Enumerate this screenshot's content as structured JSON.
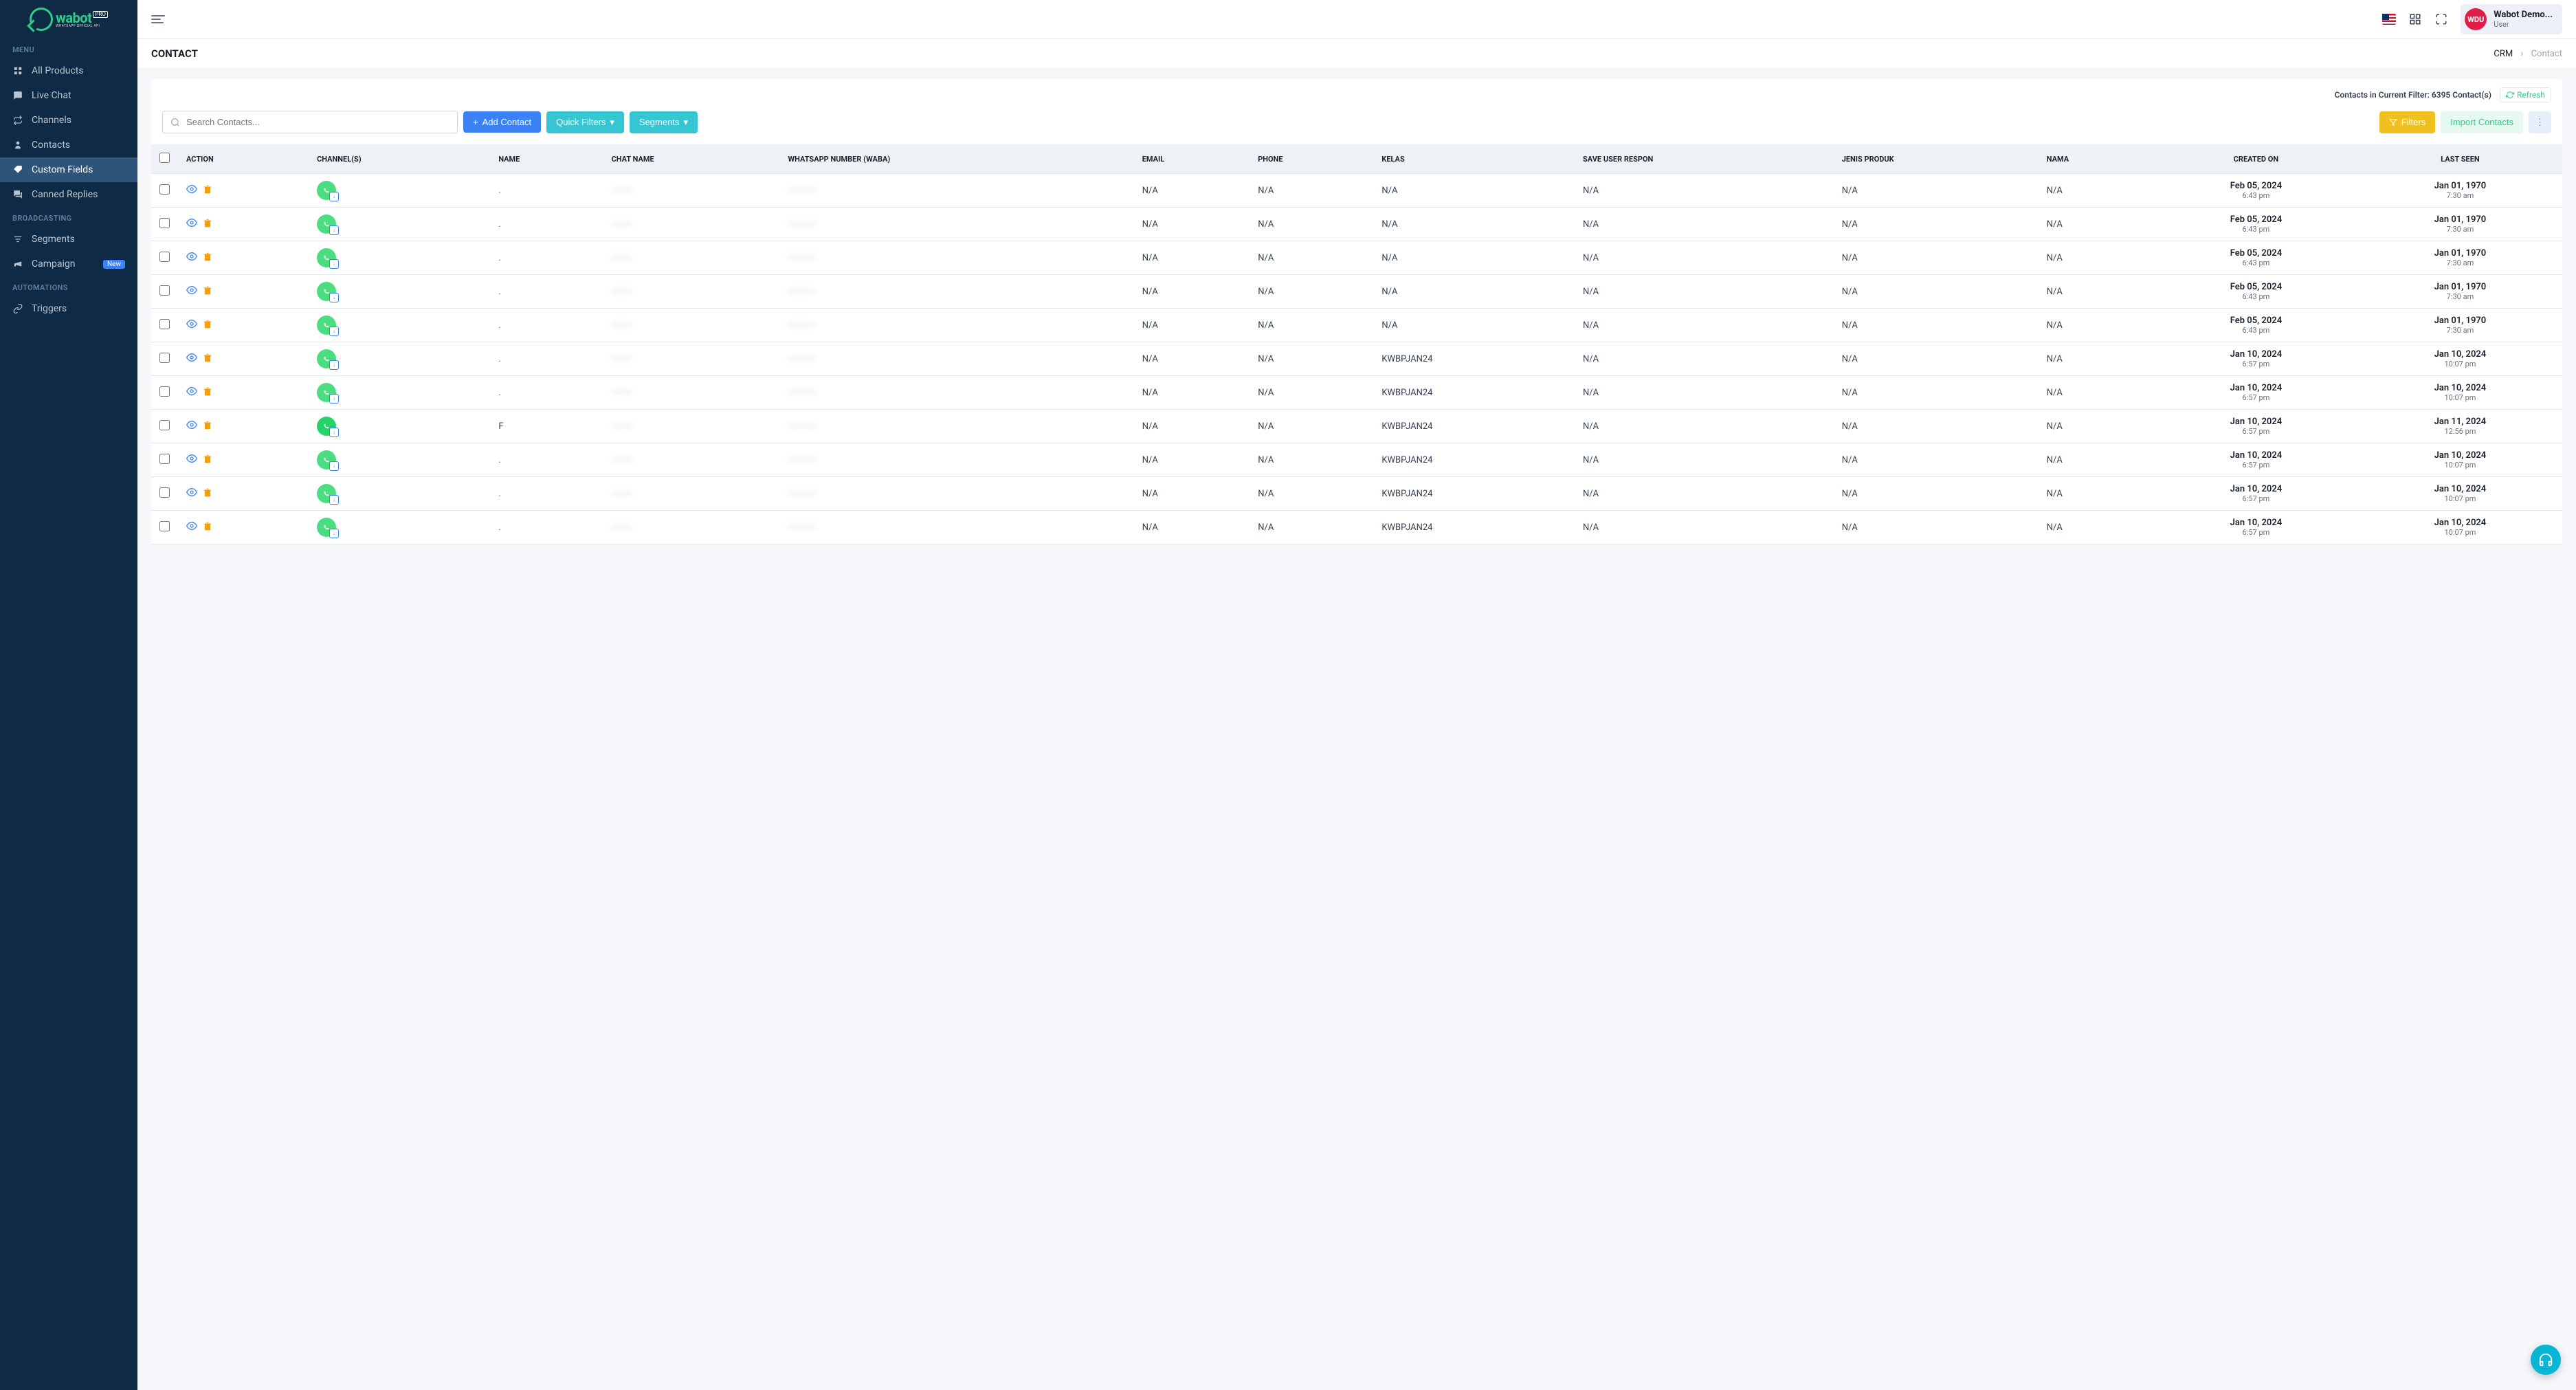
{
  "brand": {
    "name": "wabot",
    "badge": "PRO",
    "tagline": "WHATSAPP OFFICIAL API"
  },
  "sidebar": {
    "section_menu": "MENU",
    "section_broadcasting": "BROADCASTING",
    "section_automations": "AUTOMATIONS",
    "items": {
      "all_products": "All Products",
      "live_chat": "Live Chat",
      "channels": "Channels",
      "contacts": "Contacts",
      "custom_fields": "Custom Fields",
      "canned_replies": "Canned Replies",
      "segments": "Segments",
      "campaign": "Campaign",
      "triggers": "Triggers"
    },
    "badge_new": "New"
  },
  "topbar": {
    "user_name": "Wabot Demo...",
    "user_role": "User",
    "user_initials": "WDU"
  },
  "header": {
    "title": "CONTACT",
    "crumb_root": "CRM",
    "crumb_current": "Contact"
  },
  "panel": {
    "filter_count": "Contacts in Current Filter: 6395 Contact(s)",
    "refresh": "Refresh",
    "search_placeholder": "Search Contacts...",
    "btn_add": "Add Contact",
    "btn_quick": "Quick Filters",
    "btn_segments": "Segments",
    "btn_filters": "Filters",
    "btn_import": "Import Contacts"
  },
  "columns": {
    "action": "ACTION",
    "channels": "CHANNEL(S)",
    "name": "NAME",
    "chat_name": "CHAT NAME",
    "waba": "WHATSAPP NUMBER (WABA)",
    "email": "EMAIL",
    "phone": "PHONE",
    "kelas": "KELAS",
    "save_user_respon": "SAVE USER RESPON",
    "jenis_produk": "JENIS PRODUK",
    "nama": "NAMA",
    "created_on": "CREATED ON",
    "last_seen": "LAST SEEN"
  },
  "rows": [
    {
      "name": ".",
      "chat_name": "———",
      "waba": "————",
      "email": "N/A",
      "phone": "N/A",
      "kelas": "N/A",
      "save_user_respon": "N/A",
      "jenis_produk": "N/A",
      "nama": "N/A",
      "created_d": "Feb 05, 2024",
      "created_t": "6:43 pm",
      "seen_d": "Jan 01, 1970",
      "seen_t": "7:30 am",
      "channel_alt": false
    },
    {
      "name": ".",
      "chat_name": "———",
      "waba": "————",
      "email": "N/A",
      "phone": "N/A",
      "kelas": "N/A",
      "save_user_respon": "N/A",
      "jenis_produk": "N/A",
      "nama": "N/A",
      "created_d": "Feb 05, 2024",
      "created_t": "6:43 pm",
      "seen_d": "Jan 01, 1970",
      "seen_t": "7:30 am",
      "channel_alt": false
    },
    {
      "name": ".",
      "chat_name": "———",
      "waba": "————",
      "email": "N/A",
      "phone": "N/A",
      "kelas": "N/A",
      "save_user_respon": "N/A",
      "jenis_produk": "N/A",
      "nama": "N/A",
      "created_d": "Feb 05, 2024",
      "created_t": "6:43 pm",
      "seen_d": "Jan 01, 1970",
      "seen_t": "7:30 am",
      "channel_alt": false
    },
    {
      "name": ".",
      "chat_name": "———",
      "waba": "————",
      "email": "N/A",
      "phone": "N/A",
      "kelas": "N/A",
      "save_user_respon": "N/A",
      "jenis_produk": "N/A",
      "nama": "N/A",
      "created_d": "Feb 05, 2024",
      "created_t": "6:43 pm",
      "seen_d": "Jan 01, 1970",
      "seen_t": "7:30 am",
      "channel_alt": false
    },
    {
      "name": ".",
      "chat_name": "———",
      "waba": "————",
      "email": "N/A",
      "phone": "N/A",
      "kelas": "N/A",
      "save_user_respon": "N/A",
      "jenis_produk": "N/A",
      "nama": "N/A",
      "created_d": "Feb 05, 2024",
      "created_t": "6:43 pm",
      "seen_d": "Jan 01, 1970",
      "seen_t": "7:30 am",
      "channel_alt": false
    },
    {
      "name": ".",
      "chat_name": "———",
      "waba": "————",
      "email": "N/A",
      "phone": "N/A",
      "kelas": "KWBPJAN24",
      "save_user_respon": "N/A",
      "jenis_produk": "N/A",
      "nama": "N/A",
      "created_d": "Jan 10, 2024",
      "created_t": "6:57 pm",
      "seen_d": "Jan 10, 2024",
      "seen_t": "10:07 pm",
      "channel_alt": false
    },
    {
      "name": ".",
      "chat_name": "———",
      "waba": "————",
      "email": "N/A",
      "phone": "N/A",
      "kelas": "KWBPJAN24",
      "save_user_respon": "N/A",
      "jenis_produk": "N/A",
      "nama": "N/A",
      "created_d": "Jan 10, 2024",
      "created_t": "6:57 pm",
      "seen_d": "Jan 10, 2024",
      "seen_t": "10:07 pm",
      "channel_alt": false
    },
    {
      "name": "F",
      "chat_name": "———",
      "waba": "————",
      "email": "N/A",
      "phone": "N/A",
      "kelas": "KWBPJAN24",
      "save_user_respon": "N/A",
      "jenis_produk": "N/A",
      "nama": "N/A",
      "created_d": "Jan 10, 2024",
      "created_t": "6:57 pm",
      "seen_d": "Jan 11, 2024",
      "seen_t": "12:56 pm",
      "channel_alt": true
    },
    {
      "name": ".",
      "chat_name": "———",
      "waba": "————",
      "email": "N/A",
      "phone": "N/A",
      "kelas": "KWBPJAN24",
      "save_user_respon": "N/A",
      "jenis_produk": "N/A",
      "nama": "N/A",
      "created_d": "Jan 10, 2024",
      "created_t": "6:57 pm",
      "seen_d": "Jan 10, 2024",
      "seen_t": "10:07 pm",
      "channel_alt": false
    },
    {
      "name": ".",
      "chat_name": "———",
      "waba": "————",
      "email": "N/A",
      "phone": "N/A",
      "kelas": "KWBPJAN24",
      "save_user_respon": "N/A",
      "jenis_produk": "N/A",
      "nama": "N/A",
      "created_d": "Jan 10, 2024",
      "created_t": "6:57 pm",
      "seen_d": "Jan 10, 2024",
      "seen_t": "10:07 pm",
      "channel_alt": false
    },
    {
      "name": ".",
      "chat_name": "———",
      "waba": "————",
      "email": "N/A",
      "phone": "N/A",
      "kelas": "KWBPJAN24",
      "save_user_respon": "N/A",
      "jenis_produk": "N/A",
      "nama": "N/A",
      "created_d": "Jan 10, 2024",
      "created_t": "6:57 pm",
      "seen_d": "Jan 10, 2024",
      "seen_t": "10:07 pm",
      "channel_alt": false
    }
  ]
}
